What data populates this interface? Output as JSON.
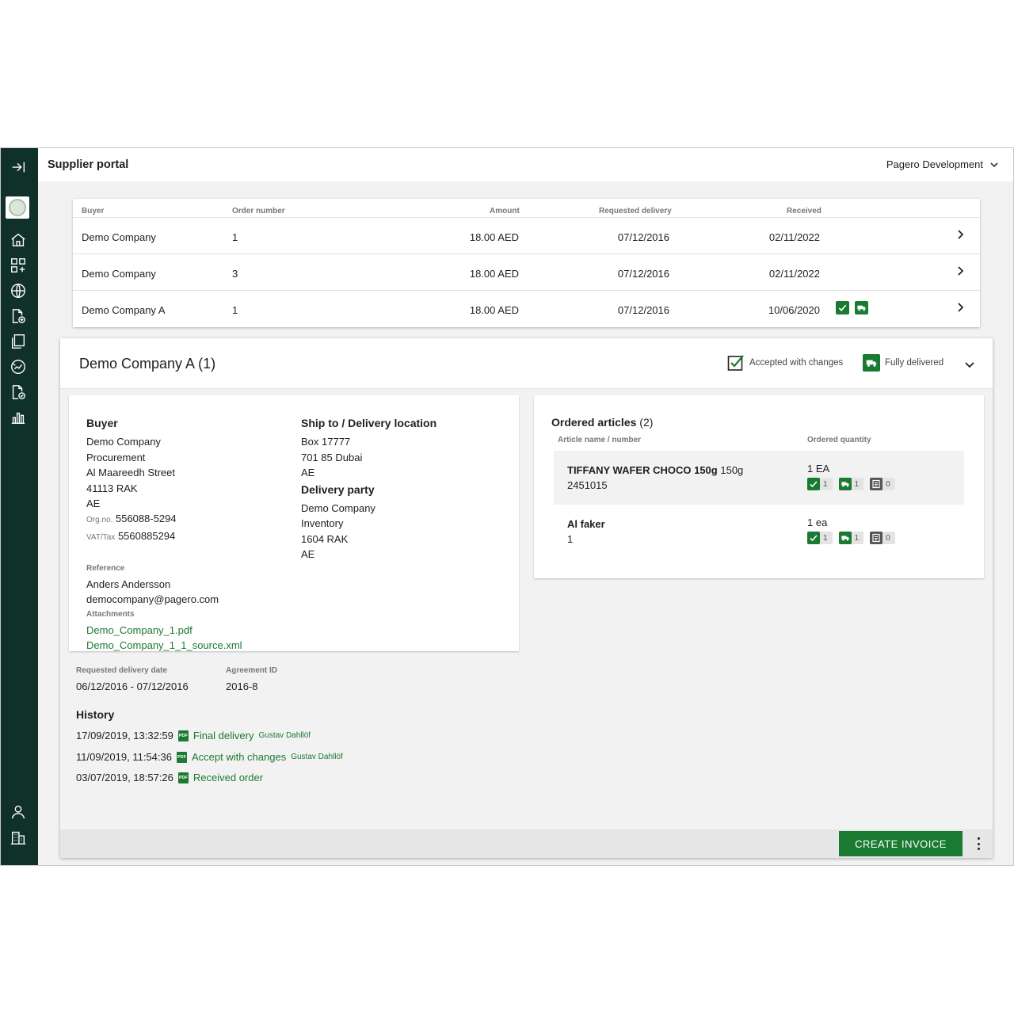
{
  "header": {
    "title": "Supplier portal",
    "org": "Pagero Development"
  },
  "sidebar": {
    "items": [
      "collapse-icon",
      "home-icon",
      "apps-icon",
      "globe-icon",
      "document-add-icon",
      "documents-icon",
      "analytics-icon",
      "document-check-icon",
      "bar-chart-icon",
      "user-icon",
      "building-icon"
    ]
  },
  "orders": {
    "columns": {
      "buyer": "Buyer",
      "order_number": "Order number",
      "amount": "Amount",
      "requested_delivery": "Requested delivery",
      "received": "Received"
    },
    "rows": [
      {
        "buyer": "Demo Company",
        "order_number": "1",
        "amount": "18.00 AED",
        "requested_delivery": "07/12/2016",
        "received": "02/11/2022",
        "status_icons": false
      },
      {
        "buyer": "Demo Company",
        "order_number": "3",
        "amount": "18.00 AED",
        "requested_delivery": "07/12/2016",
        "received": "02/11/2022",
        "status_icons": false
      },
      {
        "buyer": "Demo Company A",
        "order_number": "1",
        "amount": "18.00 AED",
        "requested_delivery": "07/12/2016",
        "received": "10/06/2020",
        "status_icons": true
      }
    ]
  },
  "detail": {
    "title": "Demo Company A (1)",
    "status_accepted": "Accepted with changes",
    "status_delivered": "Fully delivered",
    "buyer": {
      "heading": "Buyer",
      "name": "Demo Company",
      "dept": "Procurement",
      "street": "Al Maareedh Street",
      "postal": "41113 RAK",
      "country": "AE",
      "org_label": "Org.no.",
      "org_value": "556088-5294",
      "vat_label": "VAT/Tax",
      "vat_value": "5560885294",
      "reference_label": "Reference",
      "reference_name": "Anders Andersson",
      "reference_email": "democompany@pagero.com",
      "attachments_label": "Attachments",
      "attachment_1": "Demo_Company_1.pdf",
      "attachment_2": "Demo_Company_1_1_source.xml"
    },
    "ship_to": {
      "heading": "Ship to / Delivery location",
      "line1": "Box 17777",
      "line2": "701 85 Dubai",
      "line3": "AE"
    },
    "delivery_party": {
      "heading": "Delivery party",
      "line1": "Demo Company",
      "line2": "Inventory",
      "line3": "1604 RAK",
      "line4": "AE"
    },
    "articles": {
      "heading": "Ordered articles",
      "count": "(2)",
      "col_name": "Article name / number",
      "col_qty": "Ordered quantity",
      "items": [
        {
          "name": "TIFFANY WAFER CHOCO 150g",
          "name_suffix": "150g",
          "number": "2451015",
          "qty": "1 EA",
          "accepted": "1",
          "delivered": "1",
          "invoiced": "0"
        },
        {
          "name": "Al faker",
          "name_suffix": "",
          "number": "1",
          "qty": "1 ea",
          "accepted": "1",
          "delivered": "1",
          "invoiced": "0"
        }
      ]
    },
    "requested_delivery_label": "Requested delivery date",
    "requested_delivery_value": "06/12/2016 - 07/12/2016",
    "agreement_label": "Agreement ID",
    "agreement_value": "2016-8",
    "history": {
      "heading": "History",
      "items": [
        {
          "time": "17/09/2019, 13:32:59",
          "action": "Final delivery",
          "user": "Gustav Dahllöf"
        },
        {
          "time": "11/09/2019, 11:54:36",
          "action": "Accept with changes",
          "user": "Gustav Dahllöf"
        },
        {
          "time": "03/07/2019, 18:57:26",
          "action": "Received order",
          "user": ""
        }
      ]
    },
    "pdf_icon_text": "PDF",
    "create_invoice_label": "CREATE INVOICE"
  },
  "colors": {
    "brand": "#1a7a32",
    "sidebar": "#10302a"
  }
}
